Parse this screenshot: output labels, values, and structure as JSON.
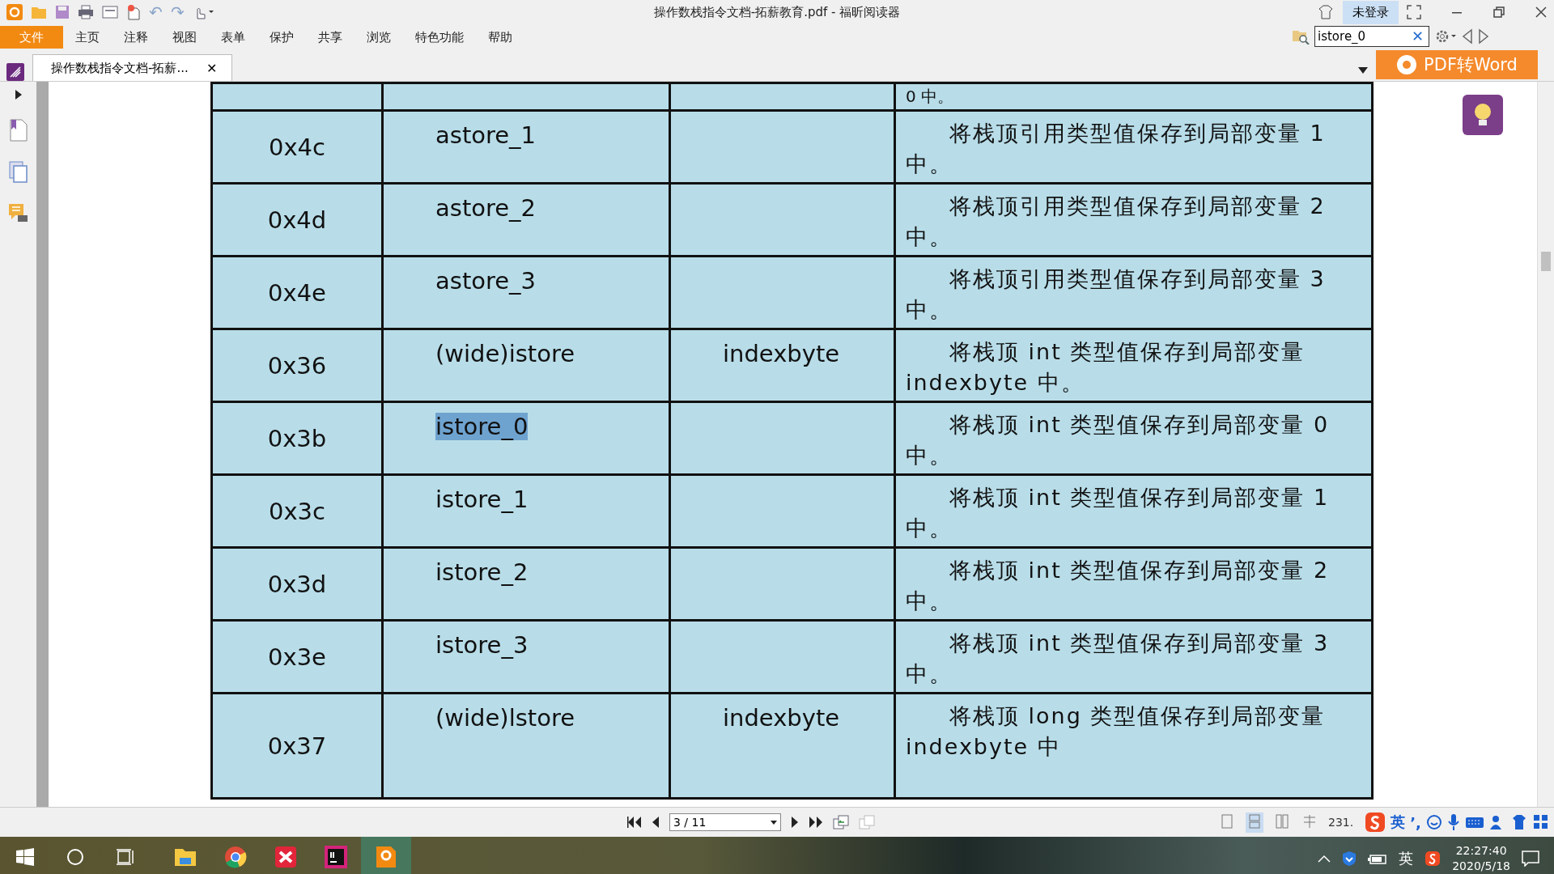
{
  "window": {
    "title": "操作数栈指令文档-拓薪教育.pdf - 福昕阅读器",
    "login": "未登录"
  },
  "quick_access": [
    "↶",
    "↷"
  ],
  "menu": [
    {
      "label": "文件",
      "selected": true
    },
    {
      "label": "主页",
      "selected": false
    },
    {
      "label": "注释",
      "selected": false
    },
    {
      "label": "视图",
      "selected": false
    },
    {
      "label": "表单",
      "selected": false
    },
    {
      "label": "保护",
      "selected": false
    },
    {
      "label": "共享",
      "selected": false
    },
    {
      "label": "浏览",
      "selected": false
    },
    {
      "label": "特色功能",
      "selected": false
    },
    {
      "label": "帮助",
      "selected": false
    }
  ],
  "search": {
    "value": "istore_0",
    "clear": "✕"
  },
  "tabs": [
    {
      "label": "操作数栈指令文档-拓薪...",
      "selected": true,
      "close": "✕"
    }
  ],
  "promo_button": "PDF转Word",
  "table": {
    "top_partial": "0 中。",
    "rows": [
      {
        "column_1": "0x4c",
        "column_2": "astore_1",
        "column_4": "将栈顶引用类型值保存到局部变量 1 中。"
      },
      {
        "column_1": "0x4d",
        "column_2": "astore_2",
        "column_4": "将栈顶引用类型值保存到局部变量 2 中。"
      },
      {
        "column_1": "0x4e",
        "column_2": "astore_3",
        "column_4": "将栈顶引用类型值保存到局部变量 3 中。"
      },
      {
        "column_1": "0x36",
        "column_2": "(wide)istore",
        "column_3": "indexbyte",
        "column_4": "将栈顶 int 类型值保存到局部变量 indexbyte 中。"
      },
      {
        "column_1": "0x3b",
        "column_2": "istore_0",
        "column_4": "将栈顶 int 类型值保存到局部变量 0 中。",
        "highlighted": true
      },
      {
        "column_1": "0x3c",
        "column_2": "istore_1",
        "column_4": "将栈顶 int 类型值保存到局部变量 1 中。"
      },
      {
        "column_1": "0x3d",
        "column_2": "istore_2",
        "column_4": "将栈顶 int 类型值保存到局部变量 2 中。"
      },
      {
        "column_1": "0x3e",
        "column_2": "istore_3",
        "column_4": "将栈顶 int 类型值保存到局部变量 3 中。"
      },
      {
        "column_1": "0x37",
        "column_2": "(wide)lstore",
        "column_3": "indexbyte",
        "column_4": "将栈顶 long 类型值保存到局部变量 indexbyte 中"
      }
    ]
  },
  "status_bar": {
    "page": "3 / 11",
    "zoom": "231.",
    "view_modes": [
      {
        "selected": false
      },
      {
        "selected": true
      },
      {
        "selected": false
      },
      {
        "selected": false
      }
    ]
  },
  "ime": {
    "mode": "英",
    "punct": "’,"
  },
  "taskbar": {
    "apps": [
      {
        "kind": "explorer",
        "selected": false
      },
      {
        "kind": "chrome",
        "selected": false
      },
      {
        "kind": "xmind",
        "selected": false
      },
      {
        "kind": "intellij",
        "selected": false
      },
      {
        "kind": "foxit",
        "selected": true
      }
    ],
    "ime": "英",
    "time": "22:27:40",
    "date": "2020/5/18"
  }
}
